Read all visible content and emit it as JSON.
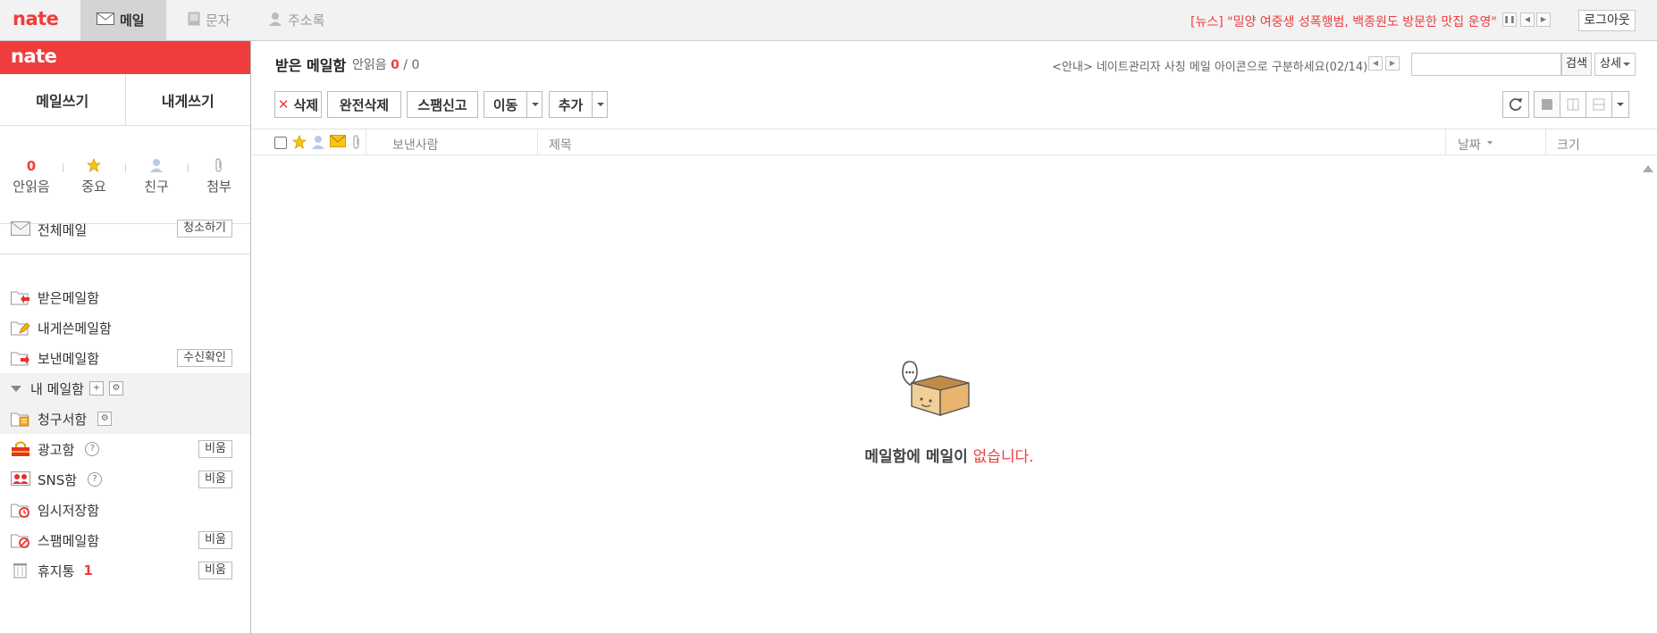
{
  "topbar": {
    "logo": "nate",
    "tabs": [
      {
        "label": "메일",
        "icon": "envelope-icon",
        "active": true
      },
      {
        "label": "문자",
        "icon": "phone-icon",
        "active": false
      },
      {
        "label": "주소록",
        "icon": "person-icon",
        "active": false
      }
    ],
    "news": "[뉴스] \"밀양 여중생 성폭행범, 백종원도 방문한 맛집 운영\" ...",
    "logout_label": "로그아웃"
  },
  "sidebar": {
    "logo": "nate",
    "write_mail": "메일쓰기",
    "write_self": "내게쓰기",
    "stats": [
      {
        "label": "안읽음",
        "value": "0",
        "icon": ""
      },
      {
        "label": "중요",
        "value": "",
        "icon": "star-icon"
      },
      {
        "label": "친구",
        "value": "",
        "icon": "person-icon"
      },
      {
        "label": "첨부",
        "value": "",
        "icon": "paperclip-icon"
      }
    ],
    "all_mail": {
      "label": "전체메일",
      "button": "청소하기"
    },
    "folders": [
      {
        "label": "받은메일함",
        "icon": "inbox-folder-icon",
        "button": ""
      },
      {
        "label": "내게쓴메일함",
        "icon": "self-folder-icon",
        "button": ""
      },
      {
        "label": "보낸메일함",
        "icon": "sent-folder-icon",
        "button": "수신확인"
      }
    ],
    "my_mailbox": "내 메일함",
    "billing": "청구서함",
    "ads": {
      "label": "광고함",
      "button": "비움"
    },
    "sns": {
      "label": "SNS함",
      "button": "비움"
    },
    "drafts": {
      "label": "임시저장함"
    },
    "spam": {
      "label": "스팸메일함",
      "button": "비움"
    },
    "trash": {
      "label": "휴지통",
      "count": "1",
      "button": "비움"
    }
  },
  "main": {
    "title": "받은 메일함",
    "unread_label": "안읽음",
    "unread_count": "0",
    "total": "/ 0",
    "notice": "<안내> 네이트관리자 사칭 메일 아이콘으로 구분하세요(02/14)",
    "search_placeholder": "",
    "search_btn": "검색",
    "detail_btn": "상세",
    "toolbar": {
      "delete": "삭제",
      "perm_delete": "완전삭제",
      "spam_report": "스팸신고",
      "move": "이동",
      "add": "추가"
    },
    "columns": {
      "sender": "보낸사람",
      "subject": "제목",
      "date": "날짜",
      "size": "크기"
    },
    "empty_prefix": "메일함에 메일이 ",
    "empty_suffix": "없습니다."
  },
  "colors": {
    "accent": "#ef3d3d",
    "box": "#e8b56f"
  }
}
